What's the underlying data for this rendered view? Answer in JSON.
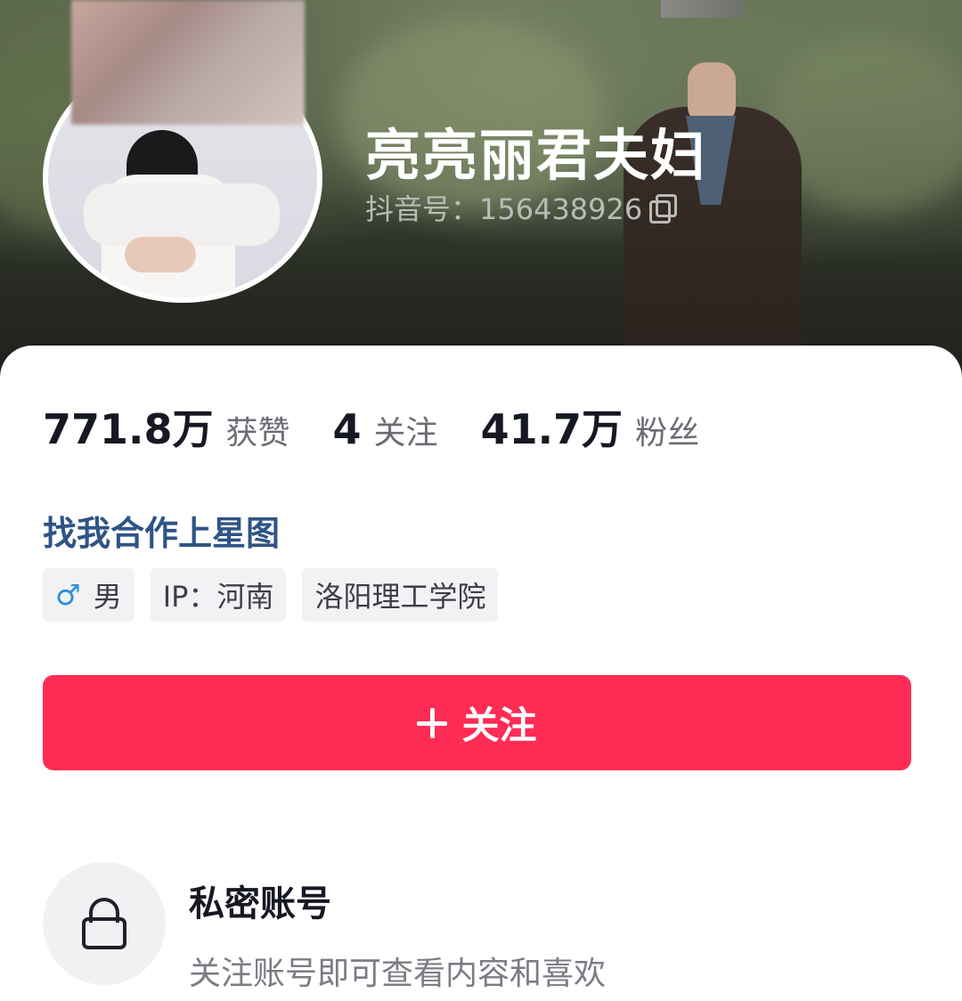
{
  "header": {
    "name": "亮亮丽君夫妇",
    "douyin_id": "抖音号：156438926",
    "copy_icon": "copy-icon"
  },
  "stats": {
    "likes_value": "771.8万",
    "likes_label": "获赞",
    "following_value": "4",
    "following_label": "关注",
    "followers_value": "41.7万",
    "followers_label": "粉丝"
  },
  "cooperate_link": "找我合作上星图",
  "tags": {
    "gender_icon": "♂",
    "gender": "男",
    "ip": "IP：河南",
    "school": "洛阳理工学院"
  },
  "follow_button": {
    "label": "关注",
    "color": "#fe2c55"
  },
  "private": {
    "title": "私密账号",
    "description": "关注账号即可查看内容和喜欢",
    "icon": "lock-icon"
  }
}
